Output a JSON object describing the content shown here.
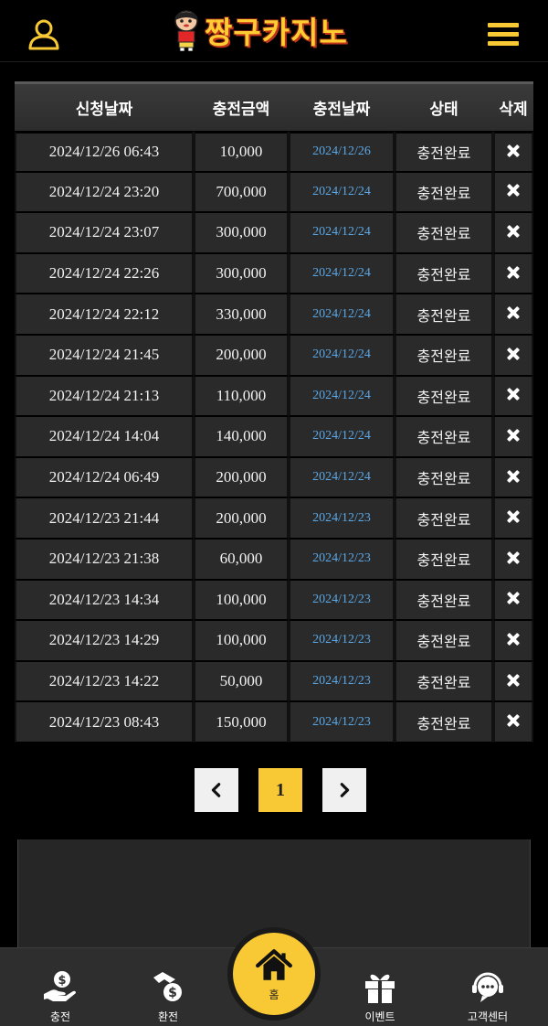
{
  "header": {
    "logo_text": "짱구카지노",
    "user_icon": "user-icon",
    "menu_icon": "hamburger-menu-icon"
  },
  "table": {
    "columns": [
      "신청날짜",
      "충전금액",
      "충전날짜",
      "상태",
      "삭제"
    ],
    "rows": [
      {
        "requested": "2024/12/26 06:43",
        "amount": "10,000",
        "charged": "2024/12/26",
        "status": "충전완료"
      },
      {
        "requested": "2024/12/24 23:20",
        "amount": "700,000",
        "charged": "2024/12/24",
        "status": "충전완료"
      },
      {
        "requested": "2024/12/24 23:07",
        "amount": "300,000",
        "charged": "2024/12/24",
        "status": "충전완료"
      },
      {
        "requested": "2024/12/24 22:26",
        "amount": "300,000",
        "charged": "2024/12/24",
        "status": "충전완료"
      },
      {
        "requested": "2024/12/24 22:12",
        "amount": "330,000",
        "charged": "2024/12/24",
        "status": "충전완료"
      },
      {
        "requested": "2024/12/24 21:45",
        "amount": "200,000",
        "charged": "2024/12/24",
        "status": "충전완료"
      },
      {
        "requested": "2024/12/24 21:13",
        "amount": "110,000",
        "charged": "2024/12/24",
        "status": "충전완료"
      },
      {
        "requested": "2024/12/24 14:04",
        "amount": "140,000",
        "charged": "2024/12/24",
        "status": "충전완료"
      },
      {
        "requested": "2024/12/24 06:49",
        "amount": "200,000",
        "charged": "2024/12/24",
        "status": "충전완료"
      },
      {
        "requested": "2024/12/23 21:44",
        "amount": "200,000",
        "charged": "2024/12/23",
        "status": "충전완료"
      },
      {
        "requested": "2024/12/23 21:38",
        "amount": "60,000",
        "charged": "2024/12/23",
        "status": "충전완료"
      },
      {
        "requested": "2024/12/23 14:34",
        "amount": "100,000",
        "charged": "2024/12/23",
        "status": "충전완료"
      },
      {
        "requested": "2024/12/23 14:29",
        "amount": "100,000",
        "charged": "2024/12/23",
        "status": "충전완료"
      },
      {
        "requested": "2024/12/23 14:22",
        "amount": "50,000",
        "charged": "2024/12/23",
        "status": "충전완료"
      },
      {
        "requested": "2024/12/23 08:43",
        "amount": "150,000",
        "charged": "2024/12/23",
        "status": "충전완료"
      }
    ],
    "delete_icon": "close-icon"
  },
  "pagination": {
    "prev_icon": "chevron-left-icon",
    "current_page": "1",
    "next_icon": "chevron-right-icon"
  },
  "bottom_nav": {
    "items": [
      {
        "label": "충전",
        "icon": "deposit-icon"
      },
      {
        "label": "환전",
        "icon": "withdraw-icon"
      },
      {
        "label": "홈",
        "icon": "home-icon"
      },
      {
        "label": "이벤트",
        "icon": "gift-icon"
      },
      {
        "label": "고객센터",
        "icon": "support-icon"
      }
    ]
  },
  "colors": {
    "accent": "#f9c935",
    "link_date": "#5aa7e6",
    "row_bg": "#2a2a2a",
    "header_bg": "#333333"
  }
}
